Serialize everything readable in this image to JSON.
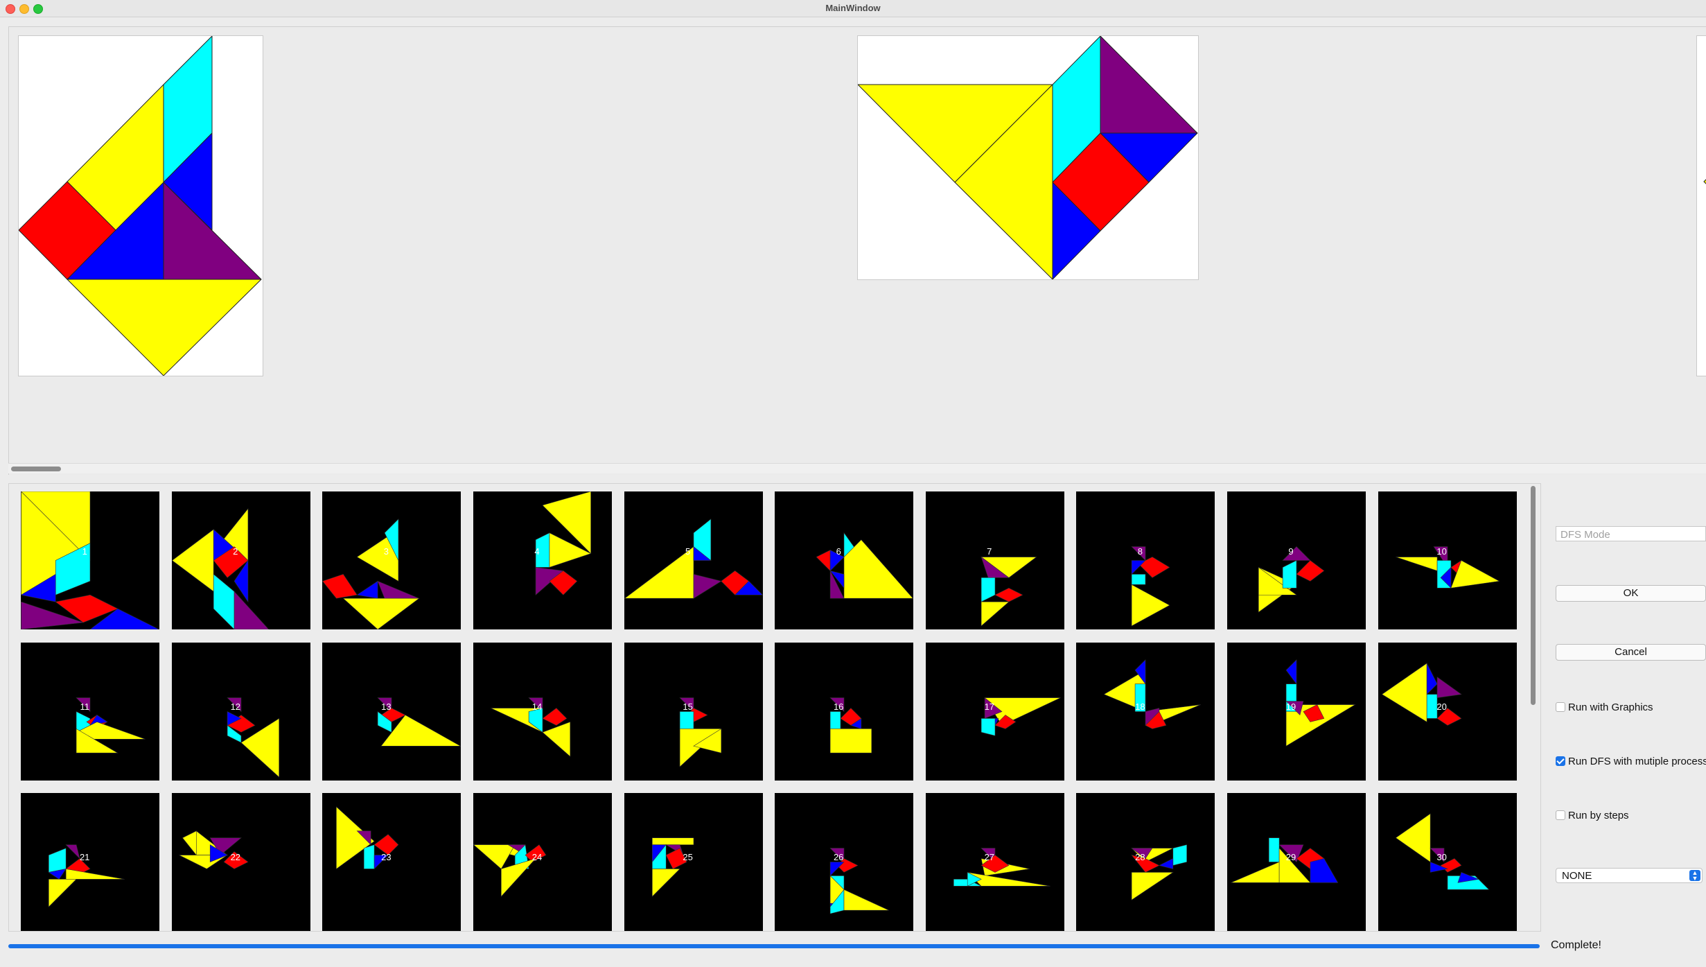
{
  "window": {
    "title": "MainWindow"
  },
  "tiles": [
    {
      "label": "1"
    },
    {
      "label": "2"
    },
    {
      "label": "3"
    },
    {
      "label": "4"
    },
    {
      "label": "5"
    },
    {
      "label": "6"
    },
    {
      "label": "7"
    },
    {
      "label": "8"
    },
    {
      "label": "9"
    },
    {
      "label": "10"
    },
    {
      "label": "11"
    },
    {
      "label": "12"
    },
    {
      "label": "13"
    },
    {
      "label": "14"
    },
    {
      "label": "15"
    },
    {
      "label": "16"
    },
    {
      "label": "17"
    },
    {
      "label": "18"
    },
    {
      "label": "19"
    },
    {
      "label": "20"
    },
    {
      "label": "21"
    },
    {
      "label": "22"
    },
    {
      "label": "23"
    },
    {
      "label": "24"
    },
    {
      "label": "25"
    },
    {
      "label": "26"
    },
    {
      "label": "27"
    },
    {
      "label": "28"
    },
    {
      "label": "29"
    },
    {
      "label": "30"
    }
  ],
  "side": {
    "mode_placeholder": "DFS Mode",
    "ok_label": "OK",
    "cancel_label": "Cancel",
    "run_graphics_label": "Run with Graphics",
    "run_graphics_checked": false,
    "run_dfs_label": "Run DFS with mutiple process",
    "run_dfs_checked": true,
    "run_steps_label": "Run by steps",
    "run_steps_checked": false,
    "select_value": "NONE"
  },
  "progress": {
    "value": 1.0,
    "status": "Complete!"
  },
  "colors": {
    "yellow": "#ffff00",
    "cyan": "#00ffff",
    "red": "#ff0000",
    "blue": "#0000ff",
    "purple": "#800080",
    "accent": "#1a73e8"
  }
}
